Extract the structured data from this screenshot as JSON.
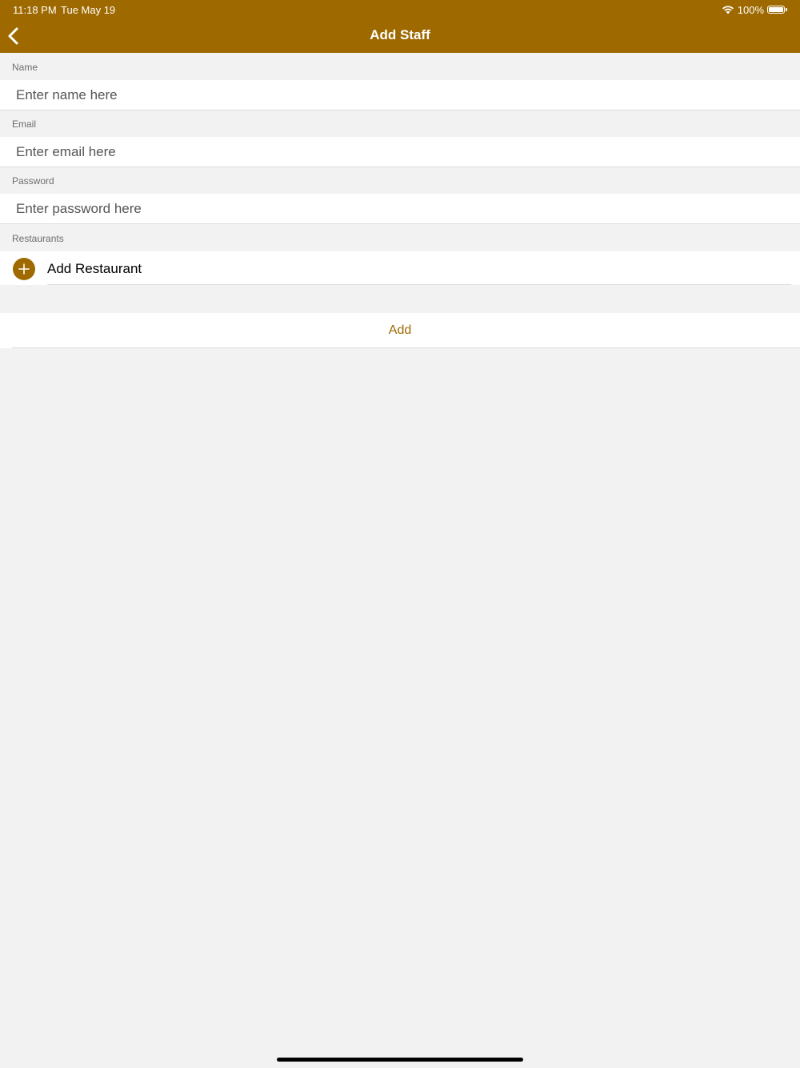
{
  "status_bar": {
    "time": "11:18 PM",
    "date": "Tue May 19",
    "battery": "100%",
    "icons": [
      "wifi-icon",
      "battery-icon"
    ]
  },
  "nav": {
    "title": "Add Staff",
    "back_icon": "chevron-left-icon"
  },
  "form": {
    "name": {
      "label": "Name",
      "placeholder": "Enter name here",
      "value": ""
    },
    "email": {
      "label": "Email",
      "placeholder": "Enter email here",
      "value": ""
    },
    "password": {
      "label": "Password",
      "placeholder": "Enter password here",
      "value": ""
    },
    "restaurants": {
      "label": "Restaurants",
      "add_label": "Add Restaurant",
      "add_icon": "plus-circle-icon"
    }
  },
  "actions": {
    "add_label": "Add"
  },
  "colors": {
    "accent": "#9e6a00",
    "background": "#f2f2f2",
    "row_background": "#ffffff",
    "label_text": "#6d6d72"
  }
}
